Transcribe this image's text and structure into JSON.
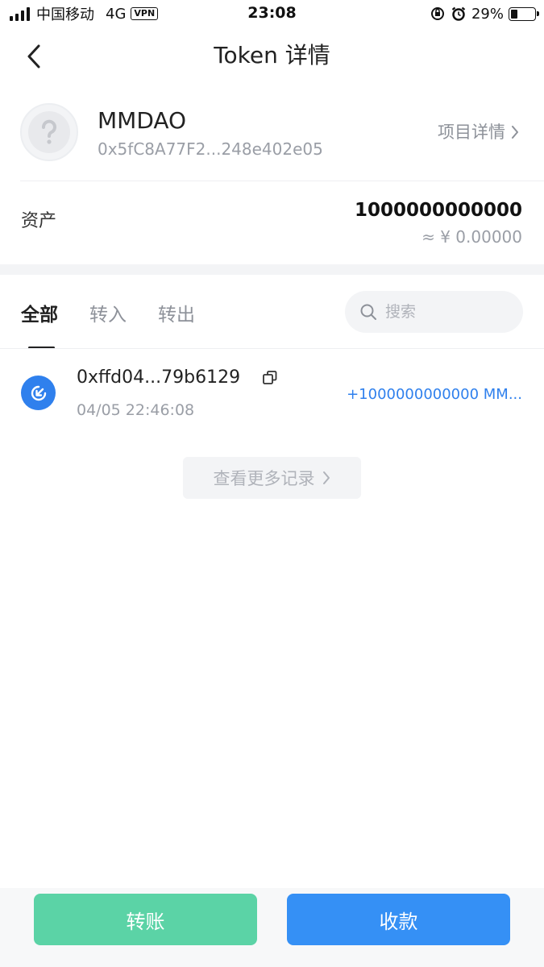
{
  "status_bar": {
    "carrier": "中国移动",
    "network": "4G",
    "vpn": "VPN",
    "time": "23:08",
    "battery": "29%",
    "battery_level": 0.29
  },
  "nav": {
    "title": "Token 详情"
  },
  "token": {
    "name": "MMDAO",
    "address": "0x5fC8A77F2...248e402e05",
    "project_link": "项目详情"
  },
  "assets": {
    "label": "资产",
    "amount": "1000000000000",
    "fiat": "≈ ¥ 0.00000"
  },
  "tabs": [
    {
      "label": "全部",
      "active": true
    },
    {
      "label": "转入",
      "active": false
    },
    {
      "label": "转出",
      "active": false
    }
  ],
  "search": {
    "placeholder": "搜索"
  },
  "transactions": [
    {
      "hash": "0xffd04...79b6129",
      "time": "04/05 22:46:08",
      "amount": "+1000000000000 MM..."
    }
  ],
  "more_records": "查看更多记录",
  "actions": {
    "transfer": "转账",
    "receive": "收款"
  },
  "colors": {
    "accent_blue": "#3590f5",
    "accent_green": "#5bd3a6",
    "incoming_blue": "#2f80ed"
  }
}
